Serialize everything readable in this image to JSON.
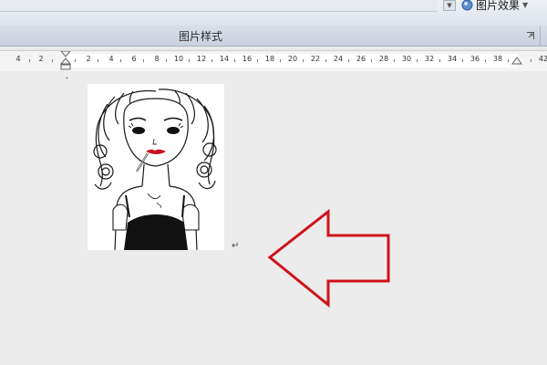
{
  "ribbon": {
    "picture_effects_label": "图片效果",
    "group_title": "图片样式"
  },
  "ruler": {
    "ticks": [
      "4",
      "2",
      "2",
      "4",
      "6",
      "8",
      "10",
      "12",
      "14",
      "16",
      "18",
      "20",
      "22",
      "24",
      "26",
      "28",
      "30",
      "32",
      "34",
      "36",
      "38",
      "42"
    ]
  },
  "document": {
    "paragraph_mark": "↵",
    "caret_mark": "˔"
  },
  "annotation": {
    "arrow_color": "#d0121b"
  }
}
